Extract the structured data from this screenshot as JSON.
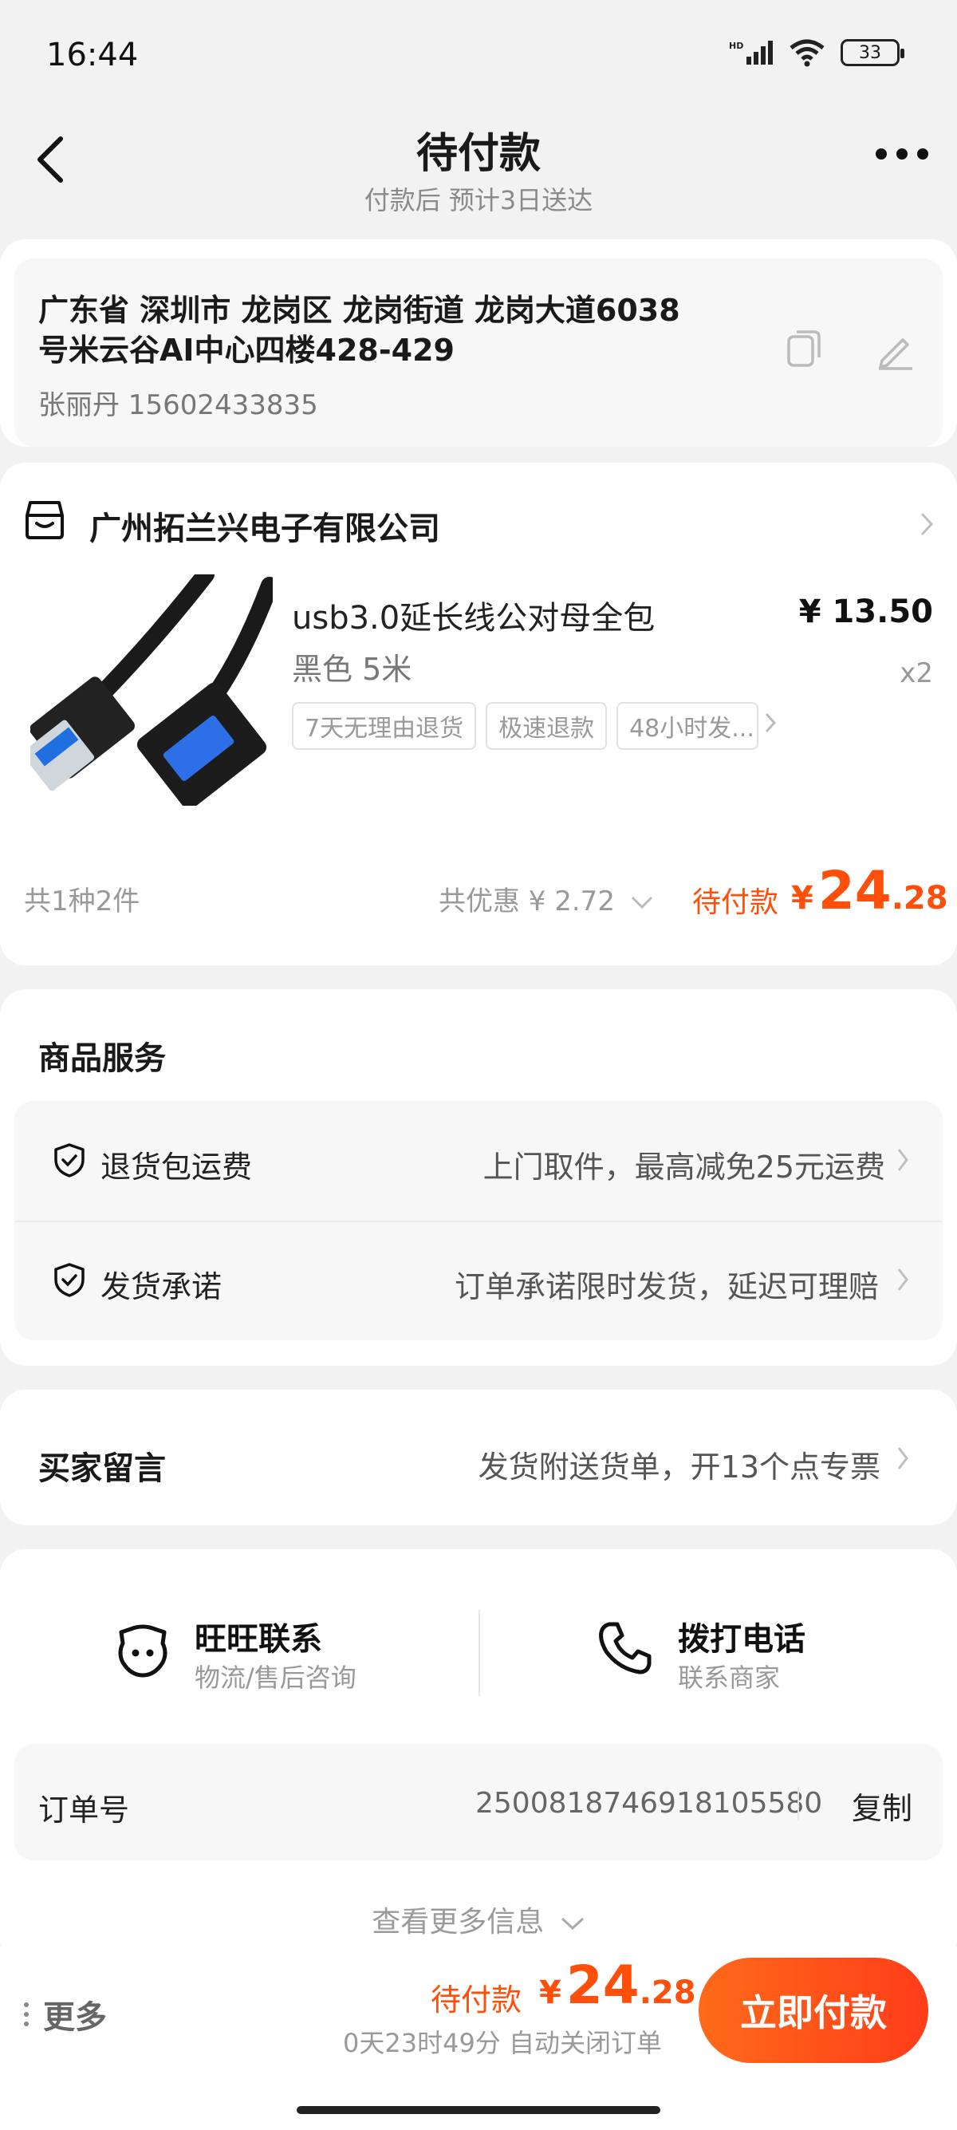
{
  "status_bar": {
    "time": "16:44",
    "battery": "33"
  },
  "header": {
    "title": "待付款",
    "subtitle": "付款后 预计3日送达"
  },
  "address": {
    "line1": "广东省 深圳市 龙岗区 龙岗街道 龙岗大道6038",
    "line2": "号米云谷AI中心四楼428-429",
    "person": "张丽丹 15602433835"
  },
  "store": {
    "name": "广州拓兰兴电子有限公司"
  },
  "product": {
    "title": "usb3.0延长线公对母全包",
    "spec": "黑色 5米",
    "price": "¥ 13.50",
    "qty": "x2",
    "tags": [
      "7天无理由退货",
      "极速退款",
      "48小时发..."
    ]
  },
  "summary": {
    "count": "共1种2件",
    "discount": "共优惠 ¥ 2.72",
    "pay_label": "待付款",
    "currency": "¥",
    "amount_int": "24",
    "amount_dec": ".28"
  },
  "services": {
    "title": "商品服务",
    "items": [
      {
        "label": "退货包运费",
        "desc": "上门取件，最高减免25元运费"
      },
      {
        "label": "发货承诺",
        "desc": "订单承诺限时发货，延迟可理赔"
      }
    ]
  },
  "buyer_message": {
    "label": "买家留言",
    "value": "发货附送货单，开13个点专票"
  },
  "contact": {
    "wangwang": {
      "title": "旺旺联系",
      "sub": "物流/售后咨询"
    },
    "phone": {
      "title": "拨打电话",
      "sub": "联系商家"
    }
  },
  "order": {
    "label": "订单号",
    "number": "2500818746918105580",
    "copy": "复制"
  },
  "view_more": "查看更多信息",
  "bottom": {
    "more": "更多",
    "pay_label": "待付款",
    "currency": "¥",
    "amount_int": "24",
    "amount_dec": ".28",
    "countdown": "0天23时49分 自动关闭订单",
    "pay_button": "立即付款"
  },
  "colors": {
    "accent": "#ff4f0a",
    "button_start": "#ff6a1a",
    "button_end": "#ff3d1a"
  }
}
